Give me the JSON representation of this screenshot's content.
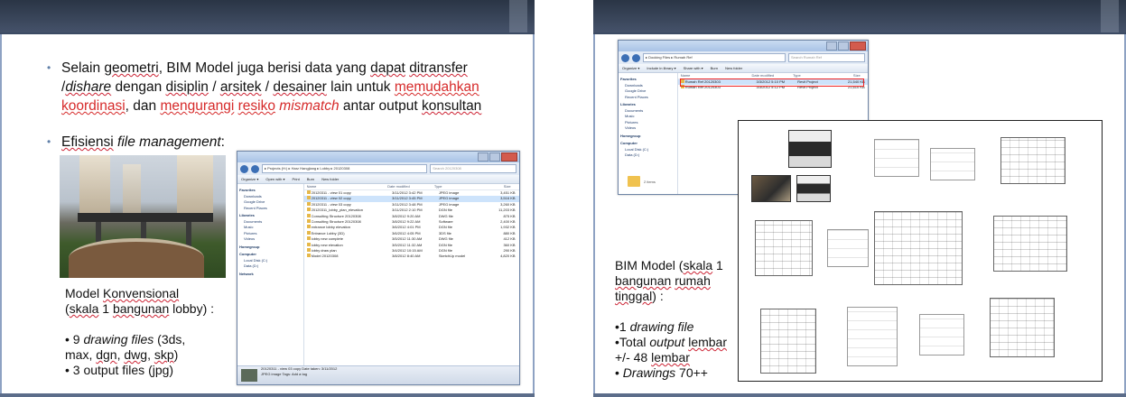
{
  "left_slide": {
    "bullet1": {
      "t1": "Selain ",
      "t2": "geometri",
      "t3": ", BIM Model juga berisi data yang ",
      "t4": "dapat",
      "t5": " ",
      "t6": "ditransfer",
      "t7": "/",
      "t8": "dishare",
      "t9": " dengan ",
      "t10": "disiplin",
      "t11": " / ",
      "t12": "arsitek",
      "t13": " / ",
      "t14": "desainer",
      "t15": " lain untuk ",
      "t16": "memudahkan koordinasi",
      "t17": ", dan ",
      "t18": "mengurangi",
      "t19": " ",
      "t20": "resiko",
      "t21": " ",
      "t22": "mismatch",
      "t23": " antar output ",
      "t24": "konsultan"
    },
    "bullet2": {
      "t1": "Efisiensi",
      "t2": " ",
      "t3": "file management",
      "t4": ":"
    },
    "caption": {
      "line1a": "Model ",
      "line1b": "Konvensional",
      "line2a": "(",
      "line2b": "skala",
      "line2c": " 1 ",
      "line2d": "bangunan",
      "line2e": "  lobby) :",
      "item1a": "• 9 ",
      "item1b": "drawing files",
      "item1c": " (3ds,",
      "item1d": "max, ",
      "item1e": "dgn",
      "item1f": ", ",
      "item1g": "dwg",
      "item1h": ", ",
      "item1i": "skp",
      "item1j": ")",
      "item2": "• 3 output  files (jpg)"
    },
    "explorer": {
      "address": "▸ Projects (H:) ▸ Harz Hangjiang ▸ Lobby ▸ 20120308",
      "search": "Search 20120308",
      "toolbar": [
        "Organize ▾",
        "Open with ▾",
        "Print",
        "Burn",
        "New folder"
      ],
      "nav": [
        {
          "hdr": "Favorites"
        },
        {
          "item": "Downloads"
        },
        {
          "item": "Google Drive"
        },
        {
          "item": "Recent Places"
        },
        {
          "hdr": "Libraries"
        },
        {
          "item": "Documents"
        },
        {
          "item": "Music"
        },
        {
          "item": "Pictures"
        },
        {
          "item": "Videos"
        },
        {
          "hdr": "Homegroup"
        },
        {
          "hdr": "Computer"
        },
        {
          "item": "Local Disk (C:)"
        },
        {
          "item": "Data (D:)"
        },
        {
          "hdr": "Network"
        }
      ],
      "columns": [
        "Name",
        "Date modified",
        "Type",
        "Size"
      ],
      "files": [
        {
          "name": "20120311 - view 01 copy",
          "date": "3/11/2012 3:42 PM",
          "type": "JPEG image",
          "size": "3,451 KB",
          "sel": false
        },
        {
          "name": "20120311 - view 02 copy",
          "date": "3/11/2012 3:45 PM",
          "type": "JPEG image",
          "size": "3,516 KB",
          "sel": true
        },
        {
          "name": "20120311 - view 03 copy",
          "date": "3/11/2012 3:48 PM",
          "type": "JPEG image",
          "size": "3,260 KB",
          "sel": false
        },
        {
          "name": "20120311_lobby_plan_elevation",
          "date": "3/11/2012 2:10 PM",
          "type": "DGN file",
          "size": "11,203 KB",
          "sel": false
        },
        {
          "name": "Consulting Structure 20120308",
          "date": "3/8/2012 9:20 AM",
          "type": "DWG file",
          "size": "875 KB",
          "sel": false
        },
        {
          "name": "Consulting Structure 20120308",
          "date": "3/8/2012 9:22 AM",
          "type": "Software",
          "size": "2,400 KB",
          "sel": false
        },
        {
          "name": "entrance lobby elevation",
          "date": "3/6/2012 4:01 PM",
          "type": "DGN file",
          "size": "1,932 KB",
          "sel": false
        },
        {
          "name": "Entrance Lobby (3D)",
          "date": "3/6/2012 4:05 PM",
          "type": "3DS file",
          "size": "880 KB",
          "sel": false
        },
        {
          "name": "lobby new complete",
          "date": "3/5/2012 11:30 AM",
          "type": "DWG file",
          "size": "412 KB",
          "sel": false
        },
        {
          "name": "lobby new elevation",
          "date": "3/5/2012 11:32 AM",
          "type": "DGN file",
          "size": "360 KB",
          "sel": false
        },
        {
          "name": "lobby draw plan",
          "date": "3/4/2012 10:15 AM",
          "type": "DGN file",
          "size": "290 KB",
          "sel": false
        },
        {
          "name": "Model 20120308",
          "date": "3/8/2012 8:40 AM",
          "type": "SketchUp model",
          "size": "4,820 KB",
          "sel": false
        }
      ],
      "status_line1": "20120311 - view 03 copy   Date taken: 3/11/2012",
      "status_line2": "JPEG image   Tags: Add a tag"
    }
  },
  "right_slide": {
    "explorer": {
      "address": "▸ Docking Files ▸ Rumah Ref",
      "search": "Search Rumah Ref",
      "toolbar": [
        "Organize ▾",
        "Include in library ▾",
        "Share with ▾",
        "Burn",
        "New folder"
      ],
      "nav": [
        {
          "hdr": "Favorites"
        },
        {
          "item": "Downloads"
        },
        {
          "item": "Google Drive"
        },
        {
          "item": "Recent Places"
        },
        {
          "hdr": "Libraries"
        },
        {
          "item": "Documents"
        },
        {
          "item": "Music"
        },
        {
          "item": "Pictures"
        },
        {
          "item": "Videos"
        },
        {
          "hdr": "Homegroup"
        },
        {
          "hdr": "Computer"
        },
        {
          "item": "Local Disk (C:)"
        },
        {
          "item": "Data (D:)"
        }
      ],
      "columns": [
        "Name",
        "Date modified",
        "Type",
        "Size"
      ],
      "files": [
        {
          "name": "Rumah Ref 20120303",
          "date": "3/3/2012 5:10 PM",
          "type": "Revit Project",
          "size": "21,540 KB",
          "sel": true
        },
        {
          "name": "Rumah Ref 20120303",
          "date": "3/3/2012 5:12 PM",
          "type": "Revit Project",
          "size": "21,610 KB",
          "sel": false
        }
      ],
      "status_line1": "2 items"
    },
    "caption": {
      "l1a": "BIM Model  (",
      "l1b": "skala",
      "l1c": " 1",
      "l2a": "bangunan",
      "l2b": " ",
      "l2c": "rumah",
      "l3a": "tinggal",
      "l3b": ") :",
      "i1a": "•1 ",
      "i1b": "drawing file",
      "i2a": "•Total ",
      "i2b": "output",
      "i2c": " ",
      "i2d": "lembar",
      "i3a": "  +/- 48 ",
      "i3b": "lembar",
      "i4a": "• ",
      "i4b": "Drawings",
      "i4c": " 70++"
    }
  }
}
